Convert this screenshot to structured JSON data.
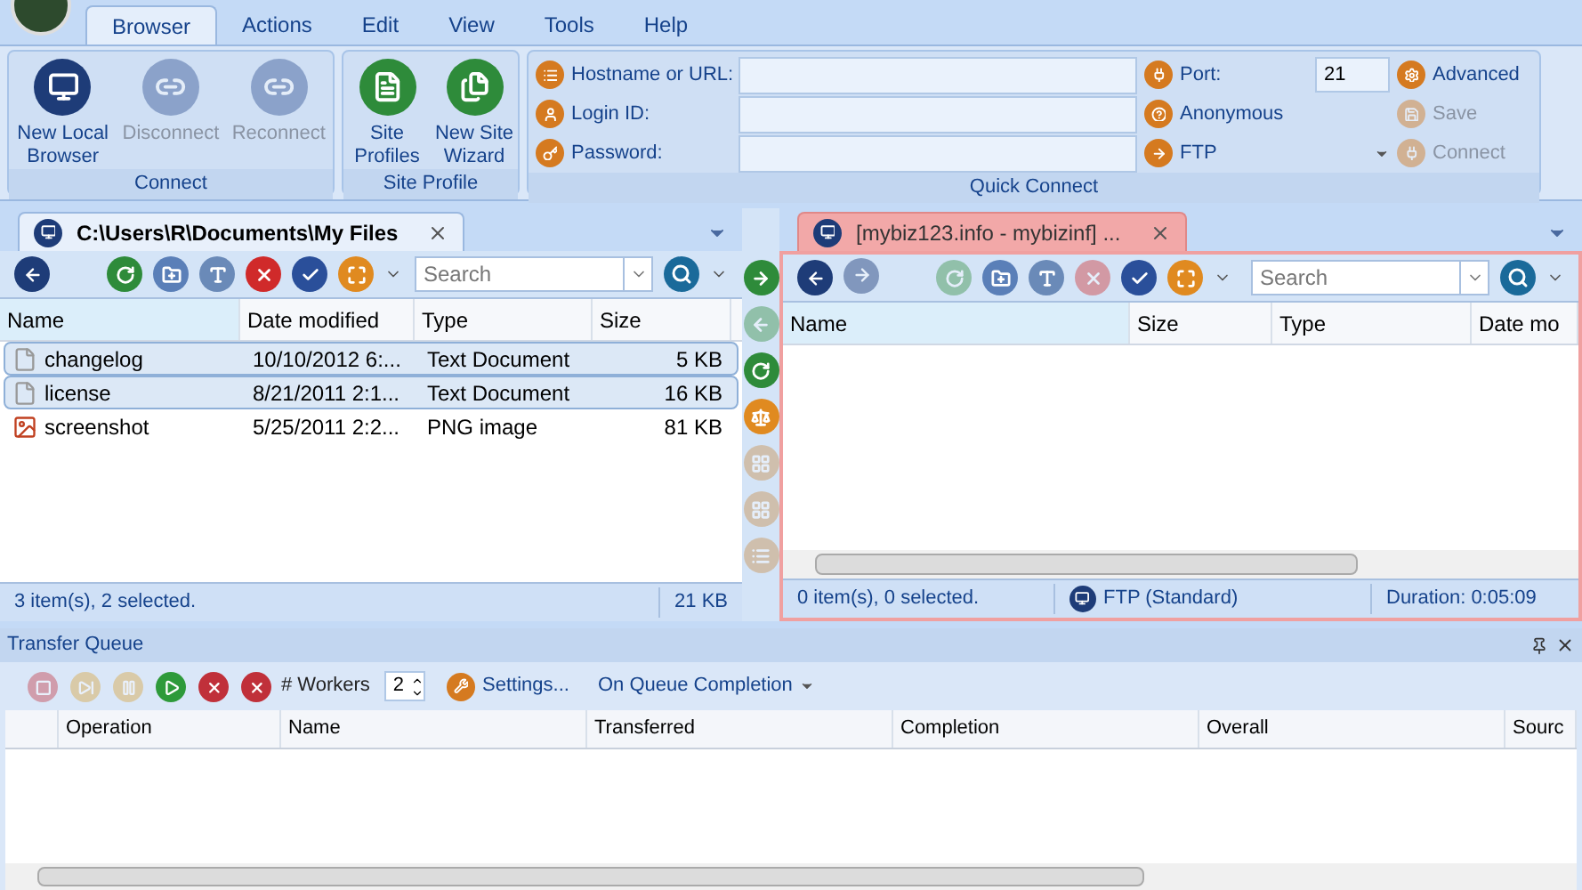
{
  "menu_tabs": [
    {
      "label": "Browser",
      "selected": true
    },
    {
      "label": "Actions",
      "selected": false
    },
    {
      "label": "Edit",
      "selected": false
    },
    {
      "label": "View",
      "selected": false
    },
    {
      "label": "Tools",
      "selected": false
    },
    {
      "label": "Help",
      "selected": false
    }
  ],
  "ribbon": {
    "connect": {
      "title": "Connect",
      "buttons": [
        {
          "kind": "local",
          "label": "New Local Browser",
          "disabled": false
        },
        {
          "kind": "disconnect",
          "label": "Disconnect",
          "disabled": true
        },
        {
          "kind": "reconnect",
          "label": "Reconnect",
          "disabled": true
        }
      ]
    },
    "site_profile": {
      "title": "Site Profile",
      "buttons": [
        {
          "kind": "profiles",
          "label": "Site Profiles"
        },
        {
          "kind": "wizard",
          "label": "New Site Wizard"
        }
      ]
    },
    "quick_connect": {
      "title": "Quick Connect",
      "fields": [
        {
          "kind": "host",
          "label": "Hostname or URL:"
        },
        {
          "kind": "login",
          "label": "Login ID:"
        },
        {
          "kind": "password",
          "label": "Password:"
        }
      ],
      "port_label": "Port:",
      "port_value": "21",
      "anonymous": "Anonymous",
      "protocol": "FTP",
      "actions": [
        {
          "kind": "advanced",
          "label": "Advanced",
          "disabled": false
        },
        {
          "kind": "save",
          "label": "Save",
          "disabled": true
        },
        {
          "kind": "connect",
          "label": "Connect",
          "disabled": true
        }
      ]
    }
  },
  "left_pane": {
    "tab_title": "C:\\Users\\R\\Documents\\My Files",
    "search_placeholder": "Search",
    "tools": [
      {
        "kind": "refresh",
        "disabled": false
      },
      {
        "kind": "newfolder",
        "disabled": false
      },
      {
        "kind": "rename",
        "disabled": false
      },
      {
        "kind": "delete",
        "disabled": false
      },
      {
        "kind": "properties",
        "disabled": false
      },
      {
        "kind": "view",
        "disabled": false
      }
    ],
    "columns": [
      "Name",
      "Date modified",
      "Type",
      "Size"
    ],
    "rows": [
      {
        "kind": "text",
        "name": "changelog",
        "date": "10/10/2012 6:...",
        "type": "Text Document",
        "size": "5 KB",
        "selected": true
      },
      {
        "kind": "text",
        "name": "license",
        "date": "8/21/2011 2:1...",
        "type": "Text Document",
        "size": "16 KB",
        "selected": true
      },
      {
        "kind": "image",
        "name": "screenshot",
        "date": "5/25/2011 2:2...",
        "type": "PNG image",
        "size": "81 KB",
        "selected": false
      }
    ],
    "status": "3 item(s), 2 selected.",
    "status_size": "21 KB"
  },
  "transfer_buttons": [
    {
      "kind": "upload",
      "disabled": false
    },
    {
      "kind": "download",
      "disabled": true
    },
    {
      "kind": "sync",
      "disabled": false
    },
    {
      "kind": "compare",
      "disabled": false
    },
    {
      "kind": "grid",
      "disabled": true
    },
    {
      "kind": "grid",
      "disabled": true
    },
    {
      "kind": "list",
      "disabled": true
    }
  ],
  "right_pane": {
    "tab_title": "[mybiz123.info - mybizinf] ...",
    "search_placeholder": "Search",
    "forward_disabled": true,
    "tools": [
      {
        "kind": "refresh",
        "disabled": true
      },
      {
        "kind": "newfolder",
        "disabled": false
      },
      {
        "kind": "rename",
        "disabled": false
      },
      {
        "kind": "delete",
        "disabled": true
      },
      {
        "kind": "properties",
        "disabled": false
      },
      {
        "kind": "view",
        "disabled": false
      }
    ],
    "columns": [
      "Name",
      "Size",
      "Type",
      "Date mo"
    ],
    "status": "0 item(s), 0 selected.",
    "protocol": "FTP (Standard)",
    "duration": "Duration: 0:05:09"
  },
  "transfer_queue": {
    "title": "Transfer Queue",
    "controls": [
      {
        "kind": "stop",
        "disabled": true
      },
      {
        "kind": "skip",
        "disabled": true
      },
      {
        "kind": "pause",
        "disabled": true
      },
      {
        "kind": "start",
        "disabled": false
      },
      {
        "kind": "cancel",
        "disabled": false
      },
      {
        "kind": "clear",
        "disabled": false
      }
    ],
    "workers_label": "# Workers",
    "workers": "2",
    "settings": "Settings...",
    "on_completion": "On Queue Completion",
    "columns": [
      "Operation",
      "Name",
      "Transferred",
      "Completion",
      "Overall",
      "Sourc"
    ]
  }
}
